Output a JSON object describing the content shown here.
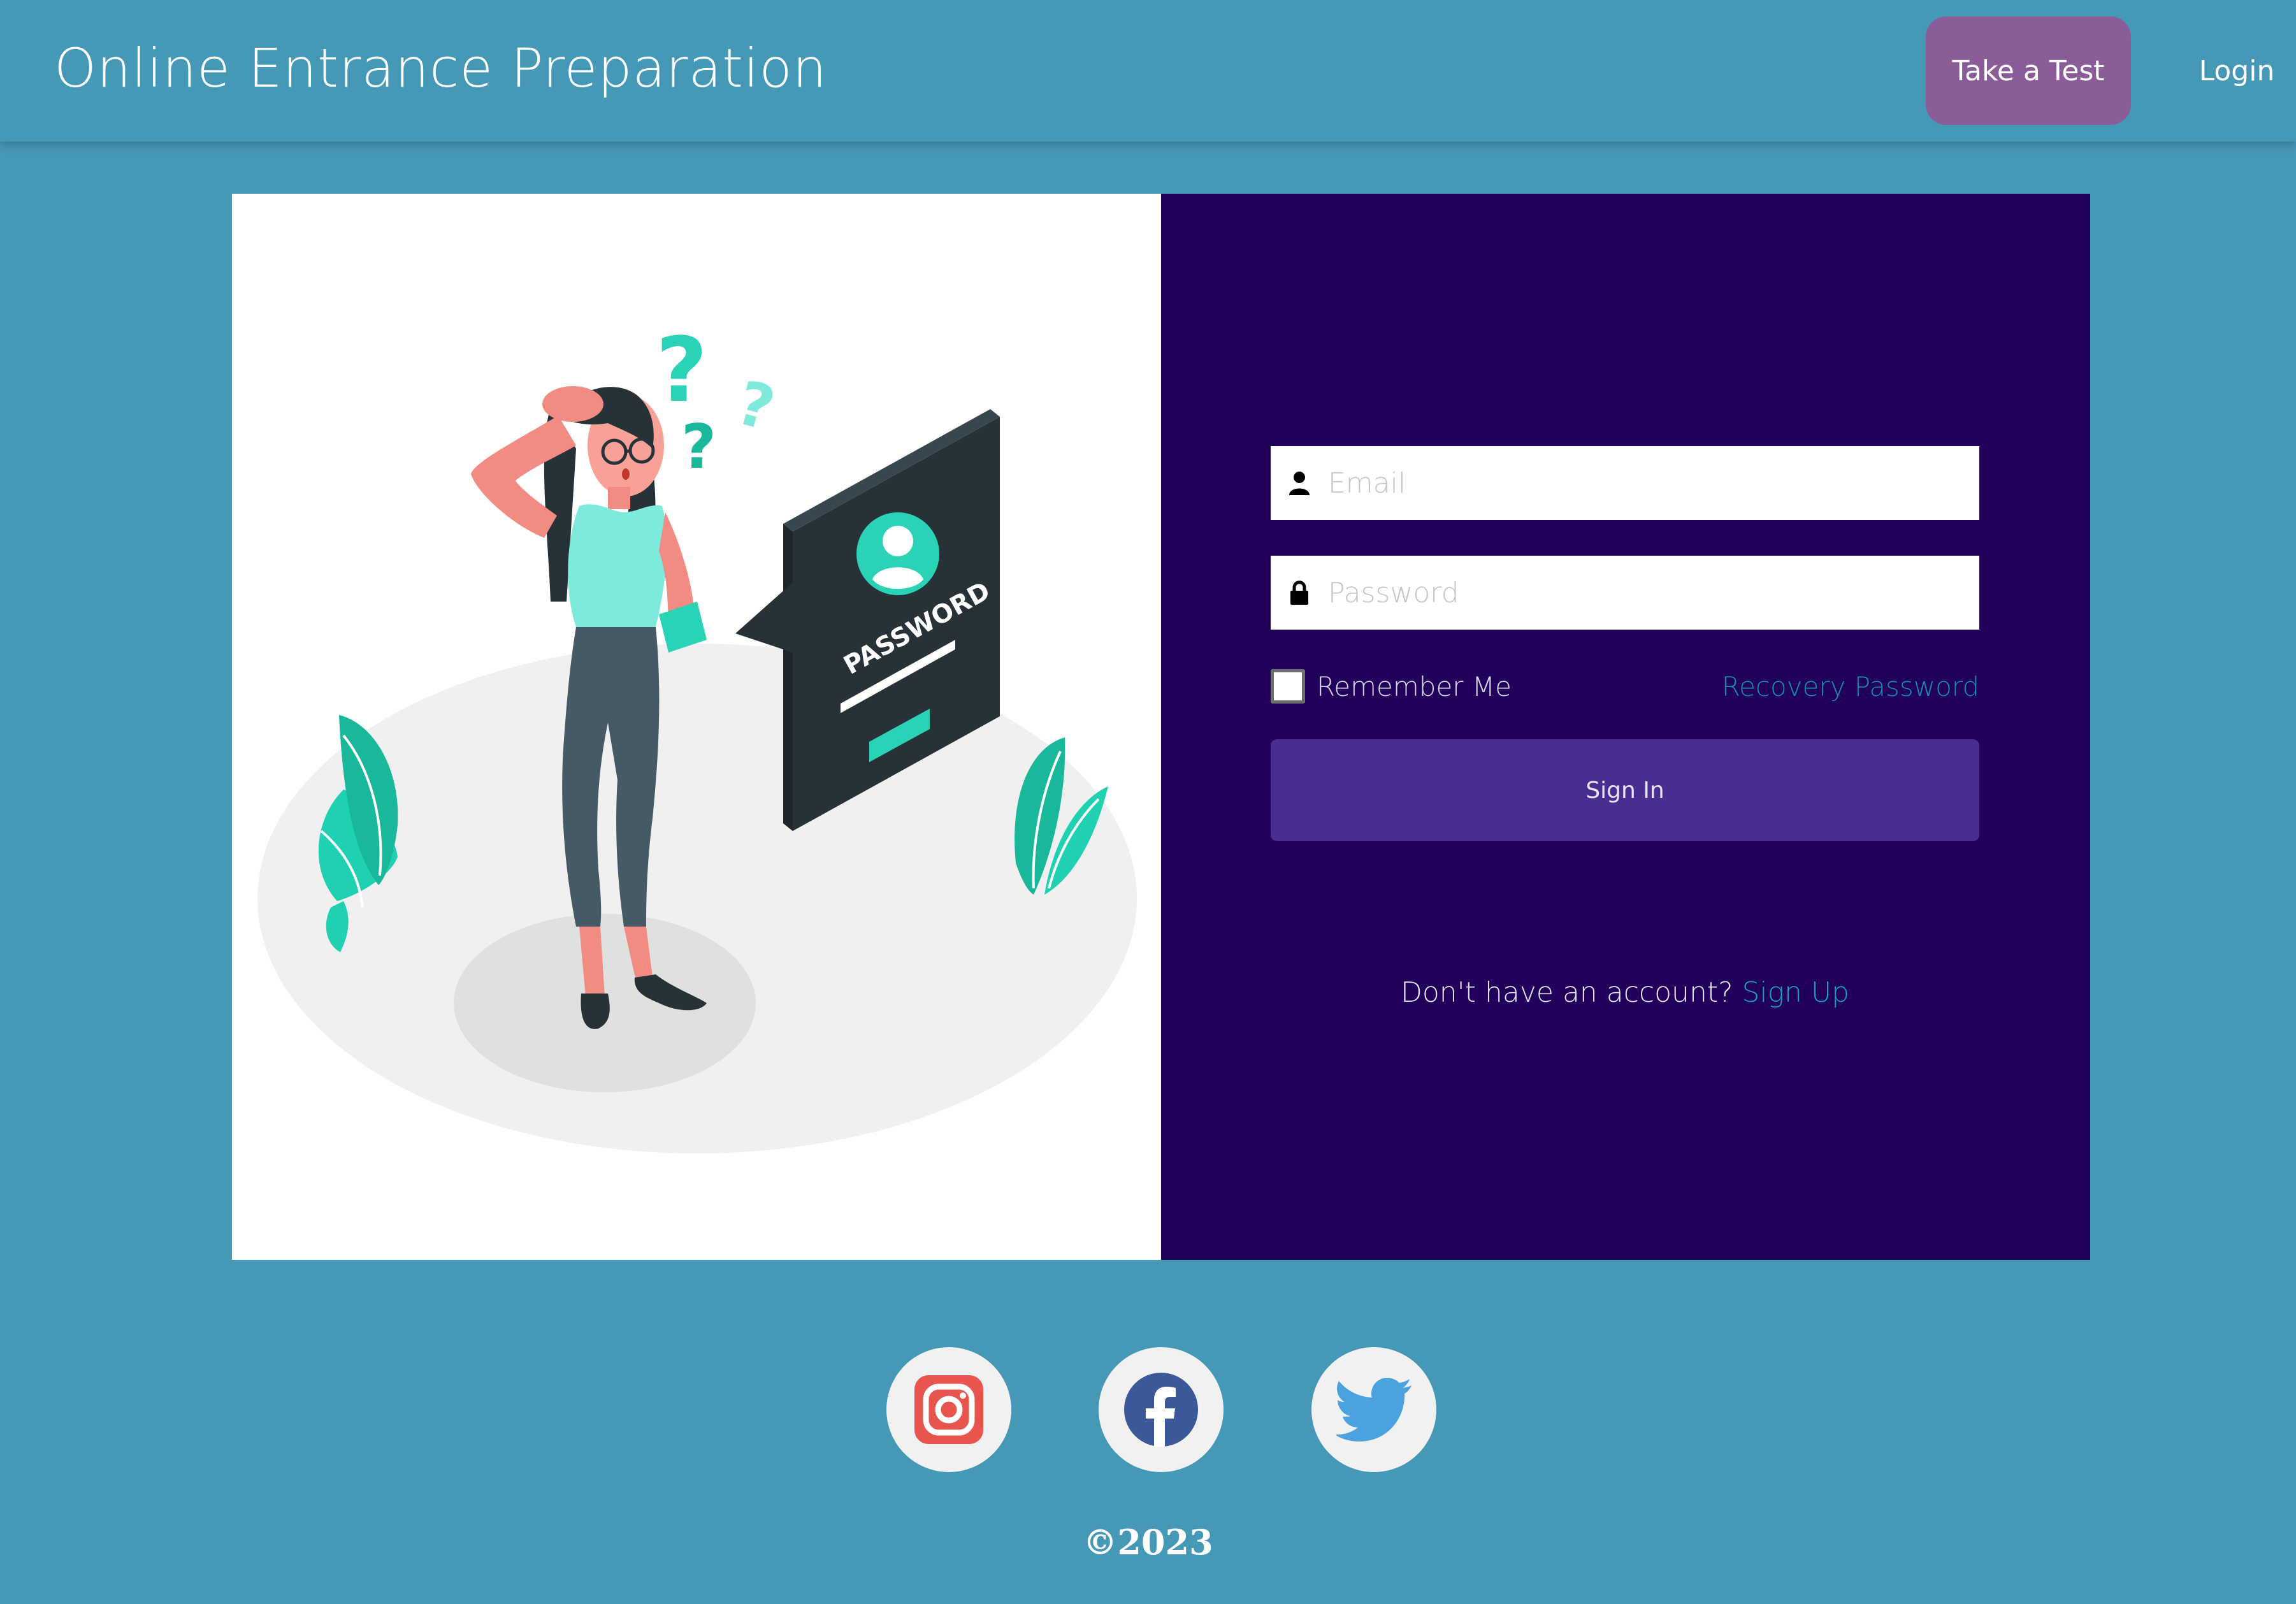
{
  "header": {
    "brand": "Online Entrance Preparation",
    "take_test_label": "Take a Test",
    "login_label": "Login"
  },
  "illustration": {
    "password_sign_text": "PASSWORD",
    "question_marks": [
      "?",
      "?",
      "?"
    ]
  },
  "form": {
    "email_placeholder": "Email",
    "password_placeholder": "Password",
    "email_icon": "user-icon",
    "password_icon": "lock-icon",
    "remember_label": "Remember Me",
    "remember_checked": false,
    "recovery_label": "Recovery Password",
    "signin_label": "Sign In",
    "signup_prompt": "Don't have an account?",
    "signup_link": "Sign Up"
  },
  "social": [
    {
      "name": "instagram-icon"
    },
    {
      "name": "facebook-icon"
    },
    {
      "name": "twitter-icon"
    }
  ],
  "footer": {
    "copyright": "©2023"
  },
  "colors": {
    "page_bg": "#4598b6",
    "take_test_bg": "#8a5d99",
    "form_panel_bg": "#21005c",
    "signin_bg": "#4a2d91",
    "link": "#1aa0c6",
    "accent_teal": "#2ad3b5"
  }
}
